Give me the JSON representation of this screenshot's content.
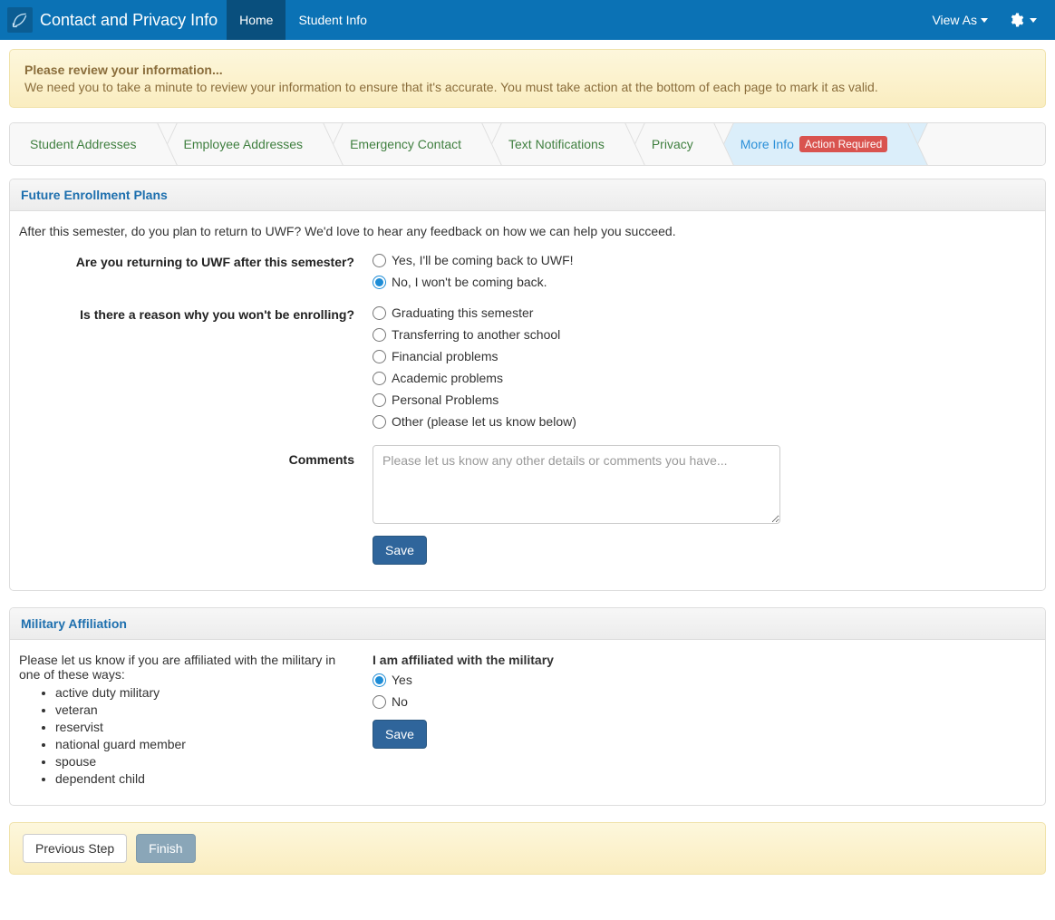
{
  "navbar": {
    "title": "Contact and Privacy Info",
    "items": [
      {
        "label": "Home",
        "active": true
      },
      {
        "label": "Student Info",
        "active": false
      }
    ],
    "viewAs": "View As"
  },
  "alert": {
    "title": "Please review your information...",
    "body": "We need you to take a minute to review your information to ensure that it's accurate. You must take action at the bottom of each page to mark it as valid."
  },
  "wizard": {
    "steps": [
      {
        "label": "Student Addresses"
      },
      {
        "label": "Employee Addresses"
      },
      {
        "label": "Emergency Contact"
      },
      {
        "label": "Text Notifications"
      },
      {
        "label": "Privacy"
      },
      {
        "label": "More Info",
        "active": true,
        "badge": "Action Required"
      }
    ]
  },
  "enrollment": {
    "header": "Future Enrollment Plans",
    "intro": "After this semester, do you plan to return to UWF? We'd love to hear any feedback on how we can help you succeed.",
    "q_return": "Are you returning to UWF after this semester?",
    "return_options": [
      {
        "label": "Yes, I'll be coming back to UWF!",
        "selected": false
      },
      {
        "label": "No, I won't be coming back.",
        "selected": true
      }
    ],
    "q_reason": "Is there a reason why you won't be enrolling?",
    "reason_options": [
      {
        "label": "Graduating this semester"
      },
      {
        "label": "Transferring to another school"
      },
      {
        "label": "Financial problems"
      },
      {
        "label": "Academic problems"
      },
      {
        "label": "Personal Problems"
      },
      {
        "label": "Other (please let us know below)"
      }
    ],
    "comments_label": "Comments",
    "comments_placeholder": "Please let us know any other details or comments you have...",
    "save": "Save"
  },
  "military": {
    "header": "Military Affiliation",
    "intro": "Please let us know if you are affiliated with the military in one of these ways:",
    "ways": [
      "active duty military",
      "veteran",
      "reservist",
      "national guard member",
      "spouse",
      "dependent child"
    ],
    "question": "I am affiliated with the military",
    "options": [
      {
        "label": "Yes",
        "selected": true
      },
      {
        "label": "No",
        "selected": false
      }
    ],
    "save": "Save"
  },
  "footer": {
    "prev": "Previous Step",
    "finish": "Finish"
  }
}
